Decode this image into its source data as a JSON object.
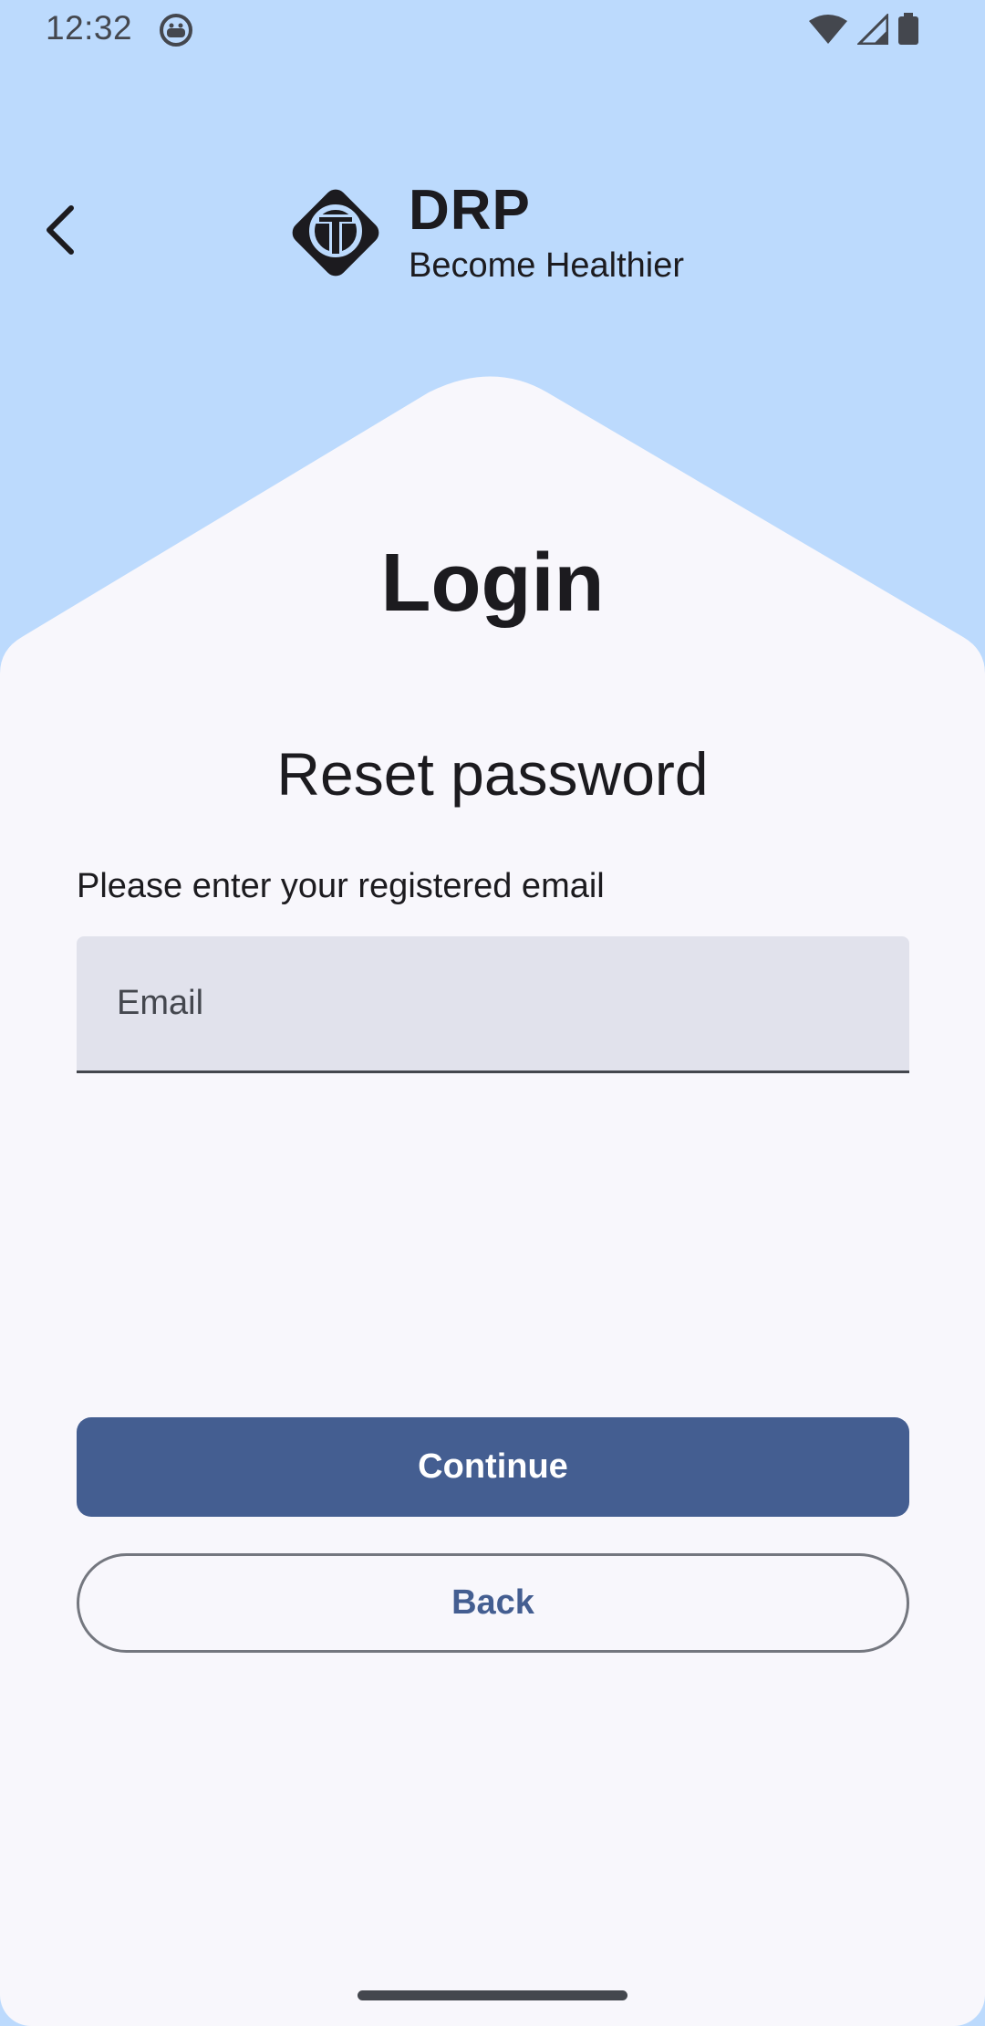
{
  "status_bar": {
    "time": "12:32",
    "app_icon": "android-face-icon",
    "icons": [
      "wifi-icon",
      "signal-icon",
      "battery-icon"
    ]
  },
  "header": {
    "back_icon": "chevron-left-icon",
    "brand_name": "DRP",
    "brand_tagline": "Become Healthier",
    "logo_icon": "t-diamond-logo"
  },
  "main": {
    "title": "Login",
    "subtitle": "Reset password",
    "instruction": "Please enter your registered email",
    "email_placeholder": "Email",
    "email_value": "",
    "continue_label": "Continue",
    "back_label": "Back"
  },
  "colors": {
    "background_top": "#bcdafd",
    "sheet": "#f8f7fc",
    "primary": "#445e91",
    "field_bg": "#e1e2ec",
    "outline": "#74777f",
    "text": "#1c1b1f"
  }
}
